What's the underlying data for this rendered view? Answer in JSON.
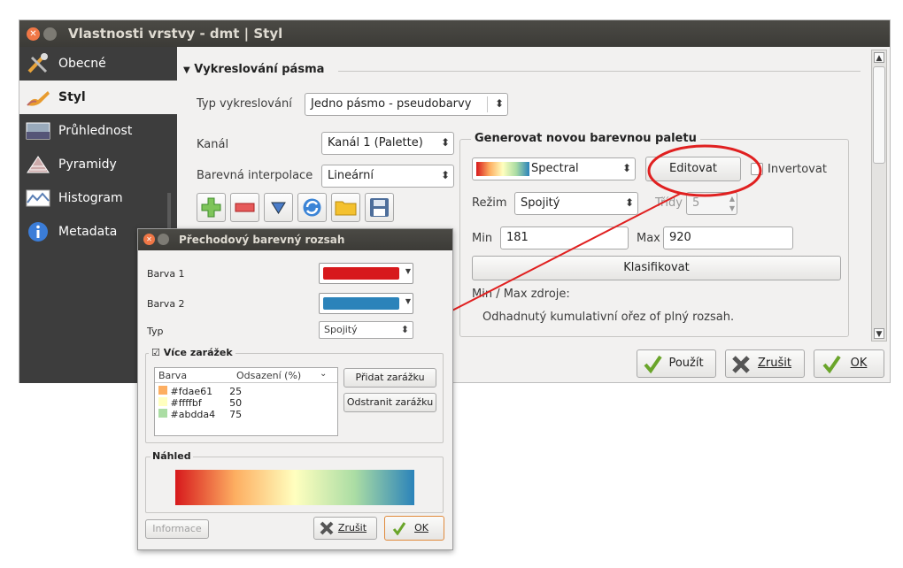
{
  "window": {
    "title": "Vlastnosti vrstvy - dmt | Styl"
  },
  "sidebar": {
    "items": [
      {
        "label": "Obecné"
      },
      {
        "label": "Styl"
      },
      {
        "label": "Průhlednost"
      },
      {
        "label": "Pyramidy"
      },
      {
        "label": "Histogram"
      },
      {
        "label": "Metadata"
      }
    ]
  },
  "render": {
    "section_title": "Vykreslování pásma",
    "type_label": "Typ vykreslování",
    "type_value": "Jedno pásmo - pseudobarvy",
    "channel_label": "Kanál",
    "channel_value": "Kanál 1 (Palette)",
    "interp_label": "Barevná interpolace",
    "interp_value": "Lineární"
  },
  "palette": {
    "title": "Generovat novou barevnou paletu",
    "ramp_name": "Spectral",
    "edit_button": "Editovat",
    "invert_label": "Invertovat",
    "mode_label": "Režim",
    "mode_value": "Spojitý",
    "classes_label": "Třídy",
    "classes_value": "5",
    "min_label": "Min",
    "min_value": "181",
    "max_label": "Max",
    "max_value": "920",
    "classify_button": "Klasifikovat",
    "source_label": "Min / Max zdroje:",
    "source_text": "Odhadnutý kumulativní ořez of plný rozsah."
  },
  "buttons": {
    "apply": "Použít",
    "cancel": "Zrušit",
    "ok": "OK"
  },
  "dialog": {
    "title": "Přechodový barevný rozsah",
    "color1_label": "Barva 1",
    "color1": "#d7191c",
    "color2_label": "Barva 2",
    "color2": "#2b83ba",
    "type_label": "Typ",
    "type_value": "Spojitý",
    "stops_label": "Více zarážek",
    "col_color": "Barva",
    "col_offset": "Odsazení (%)",
    "stops": [
      {
        "color": "#fdae61",
        "offset": "25"
      },
      {
        "color": "#ffffbf",
        "offset": "50"
      },
      {
        "color": "#abdda4",
        "offset": "75"
      }
    ],
    "add_stop": "Přidat zarážku",
    "remove_stop": "Odstranit zarážku",
    "preview_label": "Náhled",
    "info_button": "Informace",
    "cancel_button": "Zrušit",
    "ok_button": "OK"
  },
  "colors": {
    "highlight_ring": "#e02020",
    "sidebar_bg": "#3d3d3d",
    "titlebar_bg": "#3c3b37"
  }
}
